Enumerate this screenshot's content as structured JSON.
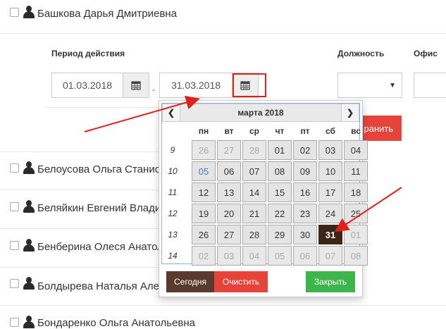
{
  "people": [
    {
      "name": "Башкова Дарья Дмитриевна"
    },
    {
      "name": "Белоусова Ольга Станисла"
    },
    {
      "name": "Беляйкин Евгений Владим"
    },
    {
      "name": "Бенберина Олеся Анатоль"
    },
    {
      "name": "Болдырева Наталья Алекс"
    },
    {
      "name": "Бондаренко Ольга Анатольевна"
    }
  ],
  "form": {
    "period_label": "Период действия",
    "position_label": "Должность",
    "office_label": "Офис",
    "date_from": "01.03.2018",
    "date_to": "31.03.2018",
    "separator": "-",
    "save_partial": "ранить"
  },
  "calendar": {
    "prev": "❮",
    "next": "❯",
    "month": "марта 2018",
    "weekdays": [
      "пн",
      "вт",
      "ср",
      "чт",
      "пт",
      "сб",
      "вс"
    ],
    "weeks": [
      {
        "num": "9",
        "days": [
          {
            "d": "26",
            "o": 1
          },
          {
            "d": "27",
            "o": 1
          },
          {
            "d": "28",
            "o": 1
          },
          {
            "d": "01"
          },
          {
            "d": "02"
          },
          {
            "d": "03"
          },
          {
            "d": "04"
          }
        ]
      },
      {
        "num": "10",
        "days": [
          {
            "d": "05",
            "t": 1
          },
          {
            "d": "06"
          },
          {
            "d": "07"
          },
          {
            "d": "08"
          },
          {
            "d": "09"
          },
          {
            "d": "10"
          },
          {
            "d": "11"
          }
        ]
      },
      {
        "num": "11",
        "days": [
          {
            "d": "12"
          },
          {
            "d": "13"
          },
          {
            "d": "14"
          },
          {
            "d": "15"
          },
          {
            "d": "16"
          },
          {
            "d": "17"
          },
          {
            "d": "18"
          }
        ]
      },
      {
        "num": "12",
        "days": [
          {
            "d": "19"
          },
          {
            "d": "20"
          },
          {
            "d": "21"
          },
          {
            "d": "22"
          },
          {
            "d": "23"
          },
          {
            "d": "24"
          },
          {
            "d": "25"
          }
        ]
      },
      {
        "num": "13",
        "days": [
          {
            "d": "26"
          },
          {
            "d": "27"
          },
          {
            "d": "28"
          },
          {
            "d": "29"
          },
          {
            "d": "30"
          },
          {
            "d": "31",
            "s": 1
          },
          {
            "d": "01",
            "o": 1
          }
        ]
      },
      {
        "num": "14",
        "days": [
          {
            "d": "02",
            "o": 1
          },
          {
            "d": "03",
            "o": 1
          },
          {
            "d": "04",
            "o": 1
          },
          {
            "d": "05",
            "o": 1
          },
          {
            "d": "06",
            "o": 1
          },
          {
            "d": "07",
            "o": 1
          },
          {
            "d": "08",
            "o": 1
          }
        ]
      }
    ],
    "today_label": "Сегодня",
    "clear_label": "Очистить",
    "close_label": "Закрыть"
  },
  "colors": {
    "accent_red": "#e8433a",
    "selected_day": "#3f2418",
    "today_btn": "#5b3a2e",
    "close_btn": "#3cb54a",
    "annotation": "#e0201b"
  }
}
